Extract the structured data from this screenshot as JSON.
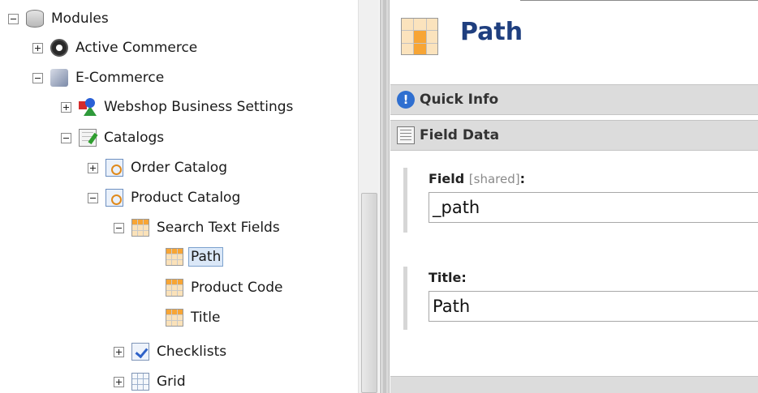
{
  "tree": {
    "modules": "Modules",
    "active_commerce": "Active Commerce",
    "ecommerce": "E-Commerce",
    "webshop_business_settings": "Webshop Business Settings",
    "catalogs": "Catalogs",
    "order_catalog": "Order Catalog",
    "product_catalog": "Product Catalog",
    "search_text_fields": "Search Text Fields",
    "path": "Path",
    "product_code": "Product Code",
    "title": "Title",
    "checklists": "Checklists",
    "grid": "Grid"
  },
  "editor": {
    "title": "Path",
    "sections": {
      "quick_info": "Quick Info",
      "field_data": "Field Data"
    },
    "fields": {
      "field_label": "Field",
      "field_shared": "[shared]",
      "field_colon": ":",
      "field_value": "_path",
      "title_label": "Title:",
      "title_value": "Path"
    }
  },
  "colors": {
    "title_blue": "#1f3f7f",
    "selection_fill": "#dbe8f8",
    "section_bar": "#dcdcdc"
  }
}
